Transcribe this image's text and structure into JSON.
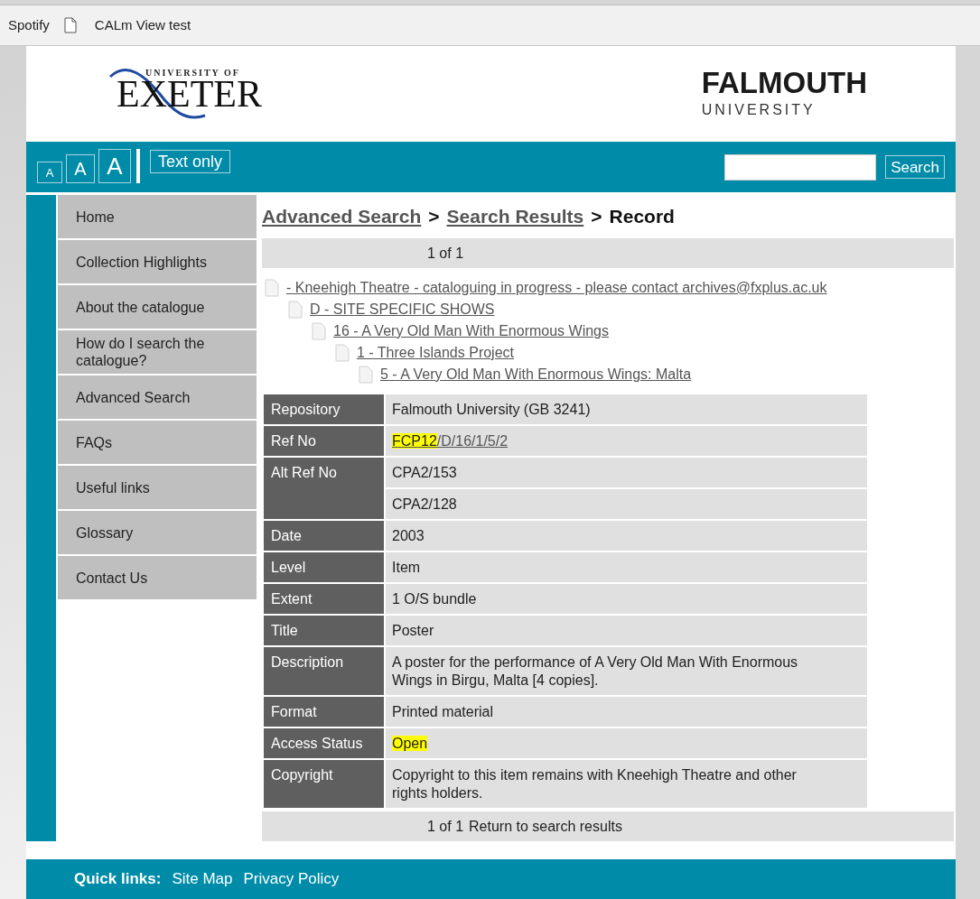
{
  "bookmarks": [
    {
      "label": "Spotify",
      "kind": "text"
    },
    {
      "label": "CALm View test",
      "kind": "page"
    }
  ],
  "header": {
    "left_logo": {
      "top": "UNIVERSITY OF",
      "main": "EXETER"
    },
    "right_logo": {
      "main": "FALMOUTH",
      "sub": "UNIVERSITY"
    }
  },
  "toolbar": {
    "text_sizes": [
      "A",
      "A",
      "A"
    ],
    "text_only": "Text only",
    "search": {
      "button": "Search"
    }
  },
  "nav": [
    {
      "label": "Home"
    },
    {
      "label": "Collection Highlights"
    },
    {
      "label": "About the catalogue"
    },
    {
      "label": "How do I search the catalogue?"
    },
    {
      "label": "Advanced Search"
    },
    {
      "label": "FAQs"
    },
    {
      "label": "Useful links"
    },
    {
      "label": "Glossary"
    },
    {
      "label": "Contact Us"
    }
  ],
  "breadcrumb": [
    {
      "label": "Advanced Search",
      "kind": "link"
    },
    {
      "label": ">",
      "kind": "separator"
    },
    {
      "label": "Search Results",
      "kind": "link"
    },
    {
      "label": ">",
      "kind": "separator"
    },
    {
      "label": "Record",
      "kind": "current"
    }
  ],
  "pager_top": "1 of 1",
  "tree": [
    {
      "label": "- Kneehigh Theatre - cataloguing in progress - please contact archives@fxplus.ac.uk",
      "children": [
        {
          "label": "D - SITE SPECIFIC SHOWS",
          "children": [
            {
              "label": "16 - A Very Old Man With Enormous Wings",
              "children": [
                {
                  "label": "1 - Three Islands Project",
                  "children": [
                    {
                      "label": "5 - A Very Old Man With Enormous Wings: Malta"
                    }
                  ]
                }
              ]
            }
          ]
        }
      ]
    }
  ],
  "record": [
    {
      "label": "Repository",
      "values": [
        {
          "link": false,
          "segments": [
            {
              "text": "Falmouth University (GB 3241)",
              "highlighted": false
            }
          ]
        }
      ]
    },
    {
      "label": "Ref No",
      "values": [
        {
          "link": true,
          "segments": [
            {
              "text": "FCP12",
              "highlighted": true
            },
            {
              "text": "/D/16/1/5/2",
              "highlighted": false
            }
          ]
        }
      ]
    },
    {
      "label": "Alt Ref No",
      "values": [
        {
          "link": false,
          "segments": [
            {
              "text": "CPA2/153",
              "highlighted": false
            }
          ]
        },
        {
          "link": false,
          "segments": [
            {
              "text": "CPA2/128",
              "highlighted": false
            }
          ]
        }
      ]
    },
    {
      "label": "Date",
      "values": [
        {
          "link": false,
          "segments": [
            {
              "text": "2003",
              "highlighted": false
            }
          ]
        }
      ]
    },
    {
      "label": "Level",
      "values": [
        {
          "link": false,
          "segments": [
            {
              "text": "Item",
              "highlighted": false
            }
          ]
        }
      ]
    },
    {
      "label": "Extent",
      "values": [
        {
          "link": false,
          "segments": [
            {
              "text": "1 O/S bundle",
              "highlighted": false
            }
          ]
        }
      ]
    },
    {
      "label": "Title",
      "values": [
        {
          "link": false,
          "segments": [
            {
              "text": "Poster",
              "highlighted": false
            }
          ]
        }
      ]
    },
    {
      "label": "Description",
      "values": [
        {
          "link": false,
          "segments": [
            {
              "text": "A poster for the performance of A Very Old Man With Enormous Wings in Birgu, Malta [4 copies].",
              "highlighted": false
            }
          ]
        }
      ]
    },
    {
      "label": "Format",
      "values": [
        {
          "link": false,
          "segments": [
            {
              "text": "Printed material",
              "highlighted": false
            }
          ]
        }
      ]
    },
    {
      "label": "Access Status",
      "values": [
        {
          "link": false,
          "segments": [
            {
              "text": "Open",
              "highlighted": true
            }
          ]
        }
      ]
    },
    {
      "label": "Copyright",
      "values": [
        {
          "link": false,
          "segments": [
            {
              "text": "Copyright to this item remains with Kneehigh Theatre and other rights holders.",
              "highlighted": false
            }
          ]
        }
      ]
    }
  ],
  "pager_bottom": {
    "count": "1 of 1",
    "link": "Return to search results"
  },
  "footer": {
    "label": "Quick links:",
    "links": [
      "Site Map",
      "Privacy Policy"
    ]
  }
}
